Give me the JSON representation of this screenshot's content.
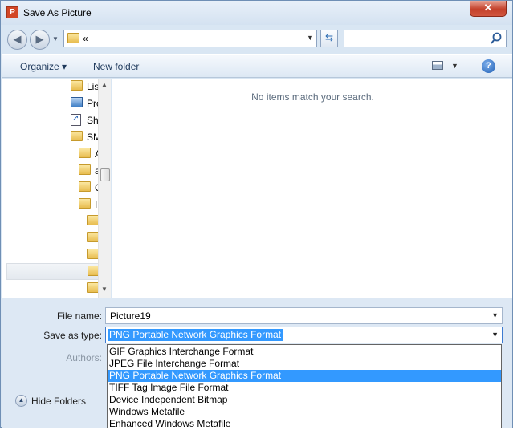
{
  "window": {
    "title": "Save As Picture",
    "app_icon_letter": "P"
  },
  "title_bar": {
    "close_glyph": "✕"
  },
  "address_bar": {
    "path_text": "«",
    "search_placeholder": ""
  },
  "toolbar": {
    "organize_label": "Organize ▾",
    "new_folder_label": "New folder",
    "help_glyph": "?"
  },
  "nav_pane": {
    "items": [
      {
        "label": "Lis",
        "icon": "folder-icon"
      },
      {
        "label": "Pro",
        "icon": "computer-icon"
      },
      {
        "label": "Sh",
        "icon": "shortcut-icon"
      },
      {
        "label": "SM",
        "icon": "folder-icon"
      },
      {
        "label": "A",
        "icon": "folder-icon"
      },
      {
        "label": "a",
        "icon": "folder-icon"
      },
      {
        "label": "C",
        "icon": "folder-icon"
      },
      {
        "label": "I",
        "icon": "folder-icon"
      },
      {
        "label": "",
        "icon": "folder-icon"
      },
      {
        "label": "",
        "icon": "folder-icon"
      },
      {
        "label": "",
        "icon": "folder-icon"
      },
      {
        "label": "",
        "icon": "folder-icon"
      },
      {
        "label": "",
        "icon": "folder-icon"
      }
    ]
  },
  "content": {
    "empty_message": "No items match your search."
  },
  "form": {
    "file_name_label": "File name:",
    "file_name_value": "Picture19",
    "save_type_label": "Save as type:",
    "save_type_value": "PNG Portable Network Graphics Format",
    "authors_label": "Authors:",
    "hide_folders_label": "Hide Folders",
    "type_options": [
      "GIF Graphics Interchange Format",
      "JPEG File Interchange Format",
      "PNG Portable Network Graphics Format",
      "TIFF Tag Image File Format",
      "Device Independent Bitmap",
      "Windows Metafile",
      "Enhanced Windows Metafile"
    ],
    "highlighted_option_index": 2
  },
  "colors": {
    "selection_blue": "#3399ff",
    "chrome_blue": "#dde8f4",
    "close_red": "#c4412b"
  }
}
